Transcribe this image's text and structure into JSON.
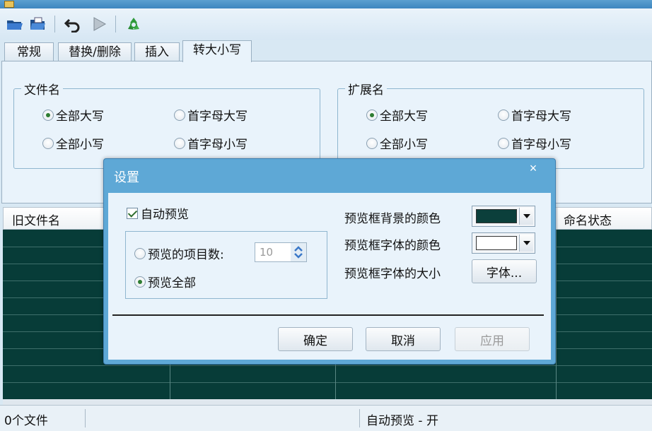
{
  "toolbar": {
    "icons": [
      "open-folder-icon",
      "open-folder-alt-icon",
      "undo-icon",
      "play-icon",
      "recycle-icon"
    ]
  },
  "tabs": [
    "常规",
    "替换/删除",
    "插入",
    "转大小写"
  ],
  "filename_group": {
    "title": "文件名",
    "options": [
      "全部大写",
      "首字母大写",
      "全部小写",
      "首字母小写"
    ],
    "selected": 0
  },
  "extension_group": {
    "title": "扩展名",
    "options": [
      "全部大写",
      "首字母大写",
      "全部小写",
      "首字母小写"
    ],
    "selected": 0
  },
  "list": {
    "columns": [
      "旧文件名",
      "命名状态"
    ],
    "background_color": "#073c38"
  },
  "status": {
    "file_count": "0个文件",
    "auto_preview": "自动预览 - 开"
  },
  "dialog": {
    "title": "设置",
    "close": "×",
    "auto_preview": {
      "label": "自动预览",
      "checked": true
    },
    "preview_count": {
      "label": "预览的项目数:",
      "value": "10",
      "selected": false
    },
    "preview_all": {
      "label": "预览全部",
      "selected": true
    },
    "bg_color": {
      "label": "预览框背景的颜色",
      "value": "#0b3f3b"
    },
    "font_color": {
      "label": "预览框字体的颜色",
      "value": "#ffffff"
    },
    "font_size": {
      "label": "预览框字体的大小",
      "button": "字体..."
    },
    "buttons": {
      "ok": "确定",
      "cancel": "取消",
      "apply": "应用"
    }
  }
}
